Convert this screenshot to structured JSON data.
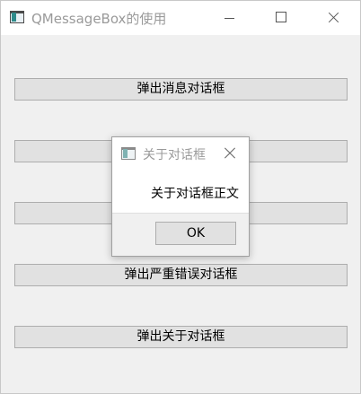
{
  "window": {
    "title": "QMessageBox的使用",
    "icon": "app-window-icon"
  },
  "buttons": [
    {
      "label": "弹出消息对话框"
    },
    {
      "label": ""
    },
    {
      "label": ""
    },
    {
      "label": "弹出严重错误对话框"
    },
    {
      "label": "弹出关于对话框"
    }
  ],
  "dialog": {
    "title": "关于对话框",
    "text": "关于对话框正文",
    "ok_label": "OK",
    "icon": "app-window-icon"
  },
  "colors": {
    "window_bg": "#f0f0f0",
    "titlebar_bg": "#ffffff",
    "button_bg": "#e1e1e1",
    "button_border": "#adadad",
    "title_text": "#9a9a9a"
  }
}
